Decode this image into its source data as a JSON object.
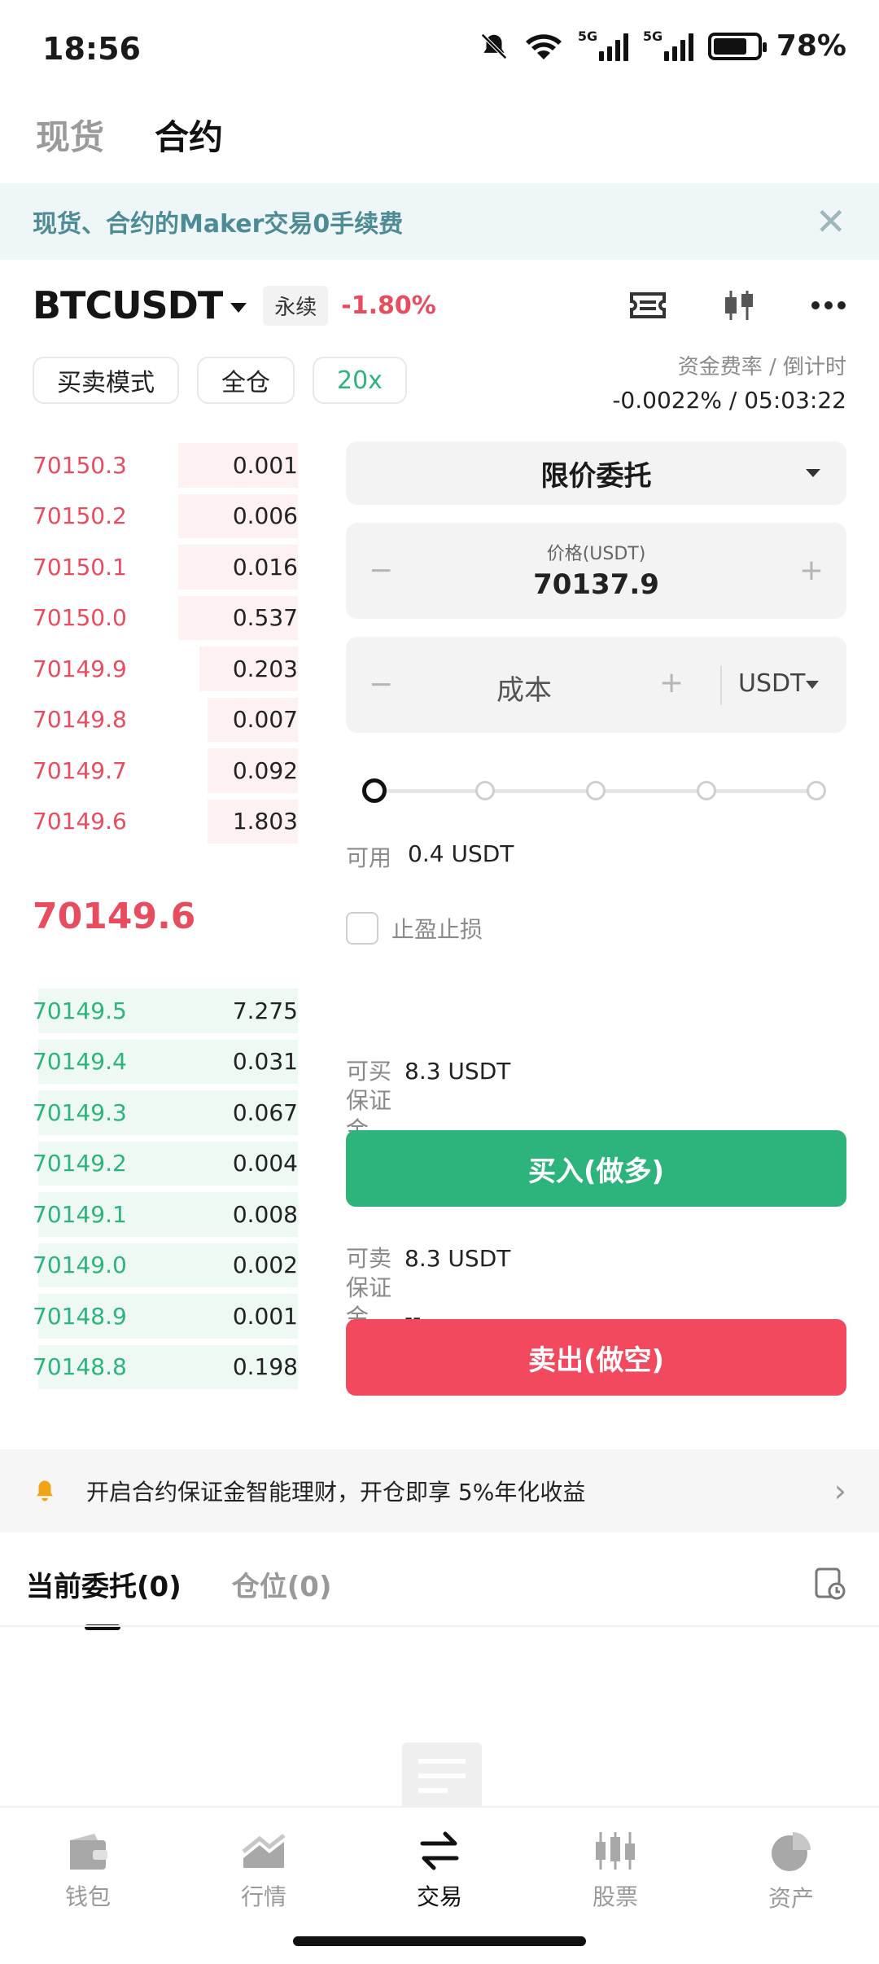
{
  "status": {
    "time": "18:56",
    "battery": "78%",
    "signal_label": "5G"
  },
  "top_tabs": {
    "spot": "现货",
    "contract": "合约"
  },
  "promo": {
    "text": "现货、合约的Maker交易0手续费",
    "close": "✕"
  },
  "symbol": {
    "name": "BTCUSDT",
    "type": "永续",
    "change": "-1.80%"
  },
  "modes": {
    "trade_mode": "买卖模式",
    "margin_mode": "全仓",
    "leverage": "20x"
  },
  "funding": {
    "label": "资金费率 / 倒计时",
    "value": "-0.0022% / 05:03:22"
  },
  "asks": [
    {
      "price": "70150.3",
      "qty": "0.001",
      "depth": 0.45
    },
    {
      "price": "70150.2",
      "qty": "0.006",
      "depth": 0.45
    },
    {
      "price": "70150.1",
      "qty": "0.016",
      "depth": 0.45
    },
    {
      "price": "70150.0",
      "qty": "0.537",
      "depth": 0.45
    },
    {
      "price": "70149.9",
      "qty": "0.203",
      "depth": 0.37
    },
    {
      "price": "70149.8",
      "qty": "0.007",
      "depth": 0.34
    },
    {
      "price": "70149.7",
      "qty": "0.092",
      "depth": 0.34
    },
    {
      "price": "70149.6",
      "qty": "1.803",
      "depth": 0.34
    }
  ],
  "last_price": "70149.6",
  "bids": [
    {
      "price": "70149.5",
      "qty": "7.275",
      "depth": 0.98
    },
    {
      "price": "70149.4",
      "qty": "0.031",
      "depth": 0.98
    },
    {
      "price": "70149.3",
      "qty": "0.067",
      "depth": 0.98
    },
    {
      "price": "70149.2",
      "qty": "0.004",
      "depth": 0.98
    },
    {
      "price": "70149.1",
      "qty": "0.008",
      "depth": 0.98
    },
    {
      "price": "70149.0",
      "qty": "0.002",
      "depth": 0.98
    },
    {
      "price": "70148.9",
      "qty": "0.001",
      "depth": 0.98
    },
    {
      "price": "70148.8",
      "qty": "0.198",
      "depth": 0.98
    }
  ],
  "form": {
    "order_type": "限价委托",
    "price_label": "价格(USDT)",
    "price_value": "70137.9",
    "minus": "−",
    "plus": "+",
    "cost_placeholder": "成本",
    "cost_unit": "USDT",
    "available_label": "可用",
    "available_value": "0.4 USDT",
    "tpsl_label": "止盈止损"
  },
  "buy": {
    "can_label": "可买",
    "can_value": "8.3 USDT",
    "margin_label": "保证金",
    "margin_value": "--",
    "button": "买入(做多)"
  },
  "sell": {
    "can_label": "可卖",
    "can_value": "8.3 USDT",
    "margin_label": "保证金",
    "margin_value": "--",
    "button": "卖出(做空)"
  },
  "earn": {
    "text": "开启合约保证金智能理财，开仓即享 5%年化收益"
  },
  "order_tabs": {
    "current": "当前委托(0)",
    "positions": "仓位(0)"
  },
  "nav": [
    {
      "label": "钱包",
      "icon": "wallet-icon"
    },
    {
      "label": "行情",
      "icon": "market-chart-icon"
    },
    {
      "label": "交易",
      "icon": "exchange-icon"
    },
    {
      "label": "股票",
      "icon": "stocks-icon"
    },
    {
      "label": "资产",
      "icon": "pie-chart-icon"
    }
  ],
  "colors": {
    "red": "#e84c5f",
    "green": "#2db47d",
    "teal_text": "#4d8b95"
  }
}
